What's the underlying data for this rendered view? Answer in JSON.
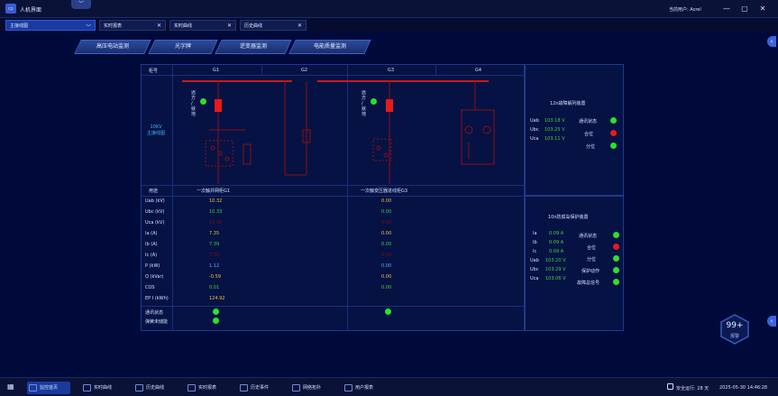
{
  "titlebar": {
    "app_title": "人机界面",
    "user_label": "当前用户: Acrel",
    "min": "—",
    "max": "▢",
    "close": "✕"
  },
  "tabs": [
    {
      "label": "主接线图",
      "close": "﹀"
    },
    {
      "label": "实时报表",
      "close": "✕"
    },
    {
      "label": "实时曲线",
      "close": "✕"
    },
    {
      "label": "历史曲线",
      "close": "✕"
    }
  ],
  "subnav": [
    "高压电站监测",
    "光字牌",
    "逆变器监测",
    "电能质量监测"
  ],
  "diagram": {
    "header_label": "柜号",
    "cabinets": [
      "G1",
      "G2",
      "G3",
      "G4"
    ],
    "left_label": "10KV\n主接线图",
    "switch_text_1": "远\n方\n/\n就\n地",
    "switch_text_2": "远\n方\n/\n就\n地"
  },
  "table": {
    "usage_label": "用途",
    "usage_g1": "一次触并网柜G1",
    "usage_g3": "一次触变压器进线柜G3",
    "rows": [
      {
        "label": "Uab (kV)",
        "g1": "10.32",
        "g1c": "y",
        "g3": "0.00",
        "g3c": "y"
      },
      {
        "label": "Ubc (kV)",
        "g1": "10.33",
        "g1c": "g",
        "g3": "0.00",
        "g3c": "g"
      },
      {
        "label": "Uca (kV)",
        "g1": "10.31",
        "g1c": "r",
        "g3": "0.00",
        "g3c": "r"
      },
      {
        "label": "Ia (A)",
        "g1": "7.35",
        "g1c": "y",
        "g3": "0.00",
        "g3c": "y"
      },
      {
        "label": "Ib (A)",
        "g1": "7.39",
        "g1c": "g",
        "g3": "0.00",
        "g3c": "g"
      },
      {
        "label": "Ic (A)",
        "g1": "7.30",
        "g1c": "r",
        "g3": "0.00",
        "g3c": "r"
      },
      {
        "label": "P (kW)",
        "g1": "1.12",
        "g1c": "b",
        "g3": "0.00",
        "g3c": "b"
      },
      {
        "label": "Q (kVar)",
        "g1": "-0.59",
        "g1c": "y",
        "g3": "0.00",
        "g3c": "y"
      },
      {
        "label": "COS",
        "g1": "0.01",
        "g1c": "g",
        "g3": "0.00",
        "g3c": "g"
      },
      {
        "label": "EP I (kWh)",
        "g1": "124.92",
        "g1c": "y",
        "g3": "",
        "g3c": "y"
      }
    ],
    "status_label_1": "通讯状态",
    "status_label_2": "弹簧未储能"
  },
  "device_12n": {
    "title": "12n故障解列装置",
    "uab_label": "Uab",
    "uab": "103.18 V",
    "ubc_label": "Ubc",
    "ubc": "103.25 V",
    "uca_label": "Uca",
    "uca": "103.11 V",
    "comm_label": "通讯状态",
    "close_label": "合位",
    "open_label": "分位"
  },
  "device_10n": {
    "title": "10n防孤岛保护装置",
    "ia_label": "Ia",
    "ia": "0.09 A",
    "ib_label": "Ib",
    "ib": "0.09 A",
    "ic_label": "Ic",
    "ic": "0.09 A",
    "uab_label": "Uab",
    "uab": "103.20 V",
    "ubc_label": "Ubc",
    "ubc": "103.29 V",
    "uca_label": "Uca",
    "uca": "103.06 V",
    "comm_label": "通讯状态",
    "close_label": "合位",
    "open_label": "分位",
    "protect_label": "保护动作",
    "fault_label": "故障总信号"
  },
  "alarm": {
    "count": "99+",
    "label": "报警"
  },
  "taskbar": {
    "items": [
      "监控首页",
      "实时曲线",
      "历史曲线",
      "实时报表",
      "历史事件",
      "网络拓扑",
      "用户报表"
    ],
    "status": "安全运行: 28 天",
    "datetime": "2025-05-30 14:46:28"
  },
  "colors": {
    "background": "#000a3a",
    "accent": "#1a3aa0",
    "busbar": "#c81a1a",
    "on": "#2ee02e",
    "off": "#e81a1a"
  }
}
